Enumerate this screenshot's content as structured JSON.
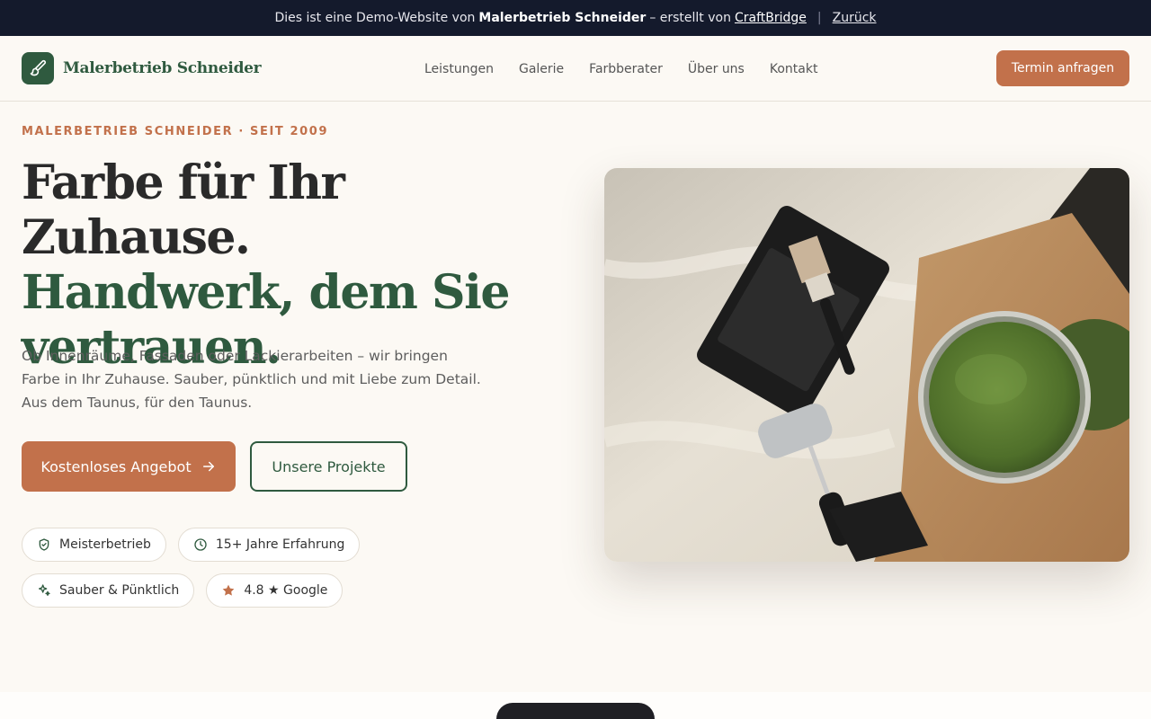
{
  "demo_bar": {
    "prefix": "Dies ist eine Demo-Website von",
    "company": "Malerbetrieb Schneider",
    "middle": "– erstellt von",
    "builder": "CraftBridge",
    "back": "Zurück"
  },
  "header": {
    "logo_text": "Malerbetrieb Schneider",
    "nav": [
      "Leistungen",
      "Galerie",
      "Farbberater",
      "Über uns",
      "Kontakt"
    ],
    "cta": "Termin anfragen"
  },
  "hero": {
    "eyebrow": "MALERBETRIEB SCHNEIDER · SEIT 2009",
    "headline_line1": "Farbe für Ihr Zuhause.",
    "headline_line2": "Handwerk, dem Sie vertrauen.",
    "lead": "Ob Innenräume, Fassaden oder Lackierarbeiten – wir bringen Farbe in Ihr Zuhause. Sauber, pünktlich und mit Liebe zum Detail. Aus dem Taunus, für den Taunus.",
    "primary_button": "Kostenloses Angebot",
    "secondary_button": "Unsere Projekte",
    "badges": [
      {
        "label": "Meisterbetrieb",
        "icon": "shield-check-icon"
      },
      {
        "label": "15+ Jahre Erfahrung",
        "icon": "clock-icon"
      },
      {
        "label": "Sauber & Pünktlich",
        "icon": "sparkles-icon"
      },
      {
        "label": "4.8 ★ Google",
        "icon": "star-icon"
      }
    ]
  },
  "colors": {
    "brand_green": "#2f5a3f",
    "accent_terracotta": "#c2714b",
    "demo_bar_bg": "#141a2c",
    "page_bg": "#fcf9f4"
  }
}
